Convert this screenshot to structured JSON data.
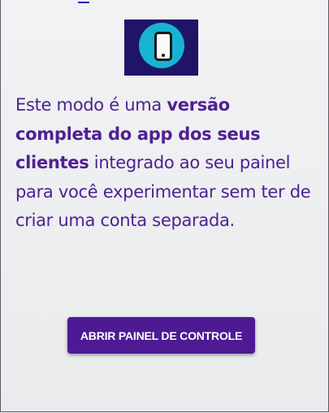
{
  "hero_icon": "smartphone-icon",
  "colors": {
    "accent": "#4d1a94",
    "text": "#4f2191",
    "icon_tile": "#1f1466",
    "icon_circle": "#18b2d4"
  },
  "description": {
    "part1": "Este modo é uma ",
    "highlight": "versão completa do app dos seus clientes",
    "part2": " integrado ao seu painel para você experimentar sem ter de criar uma conta separada."
  },
  "cta_button": {
    "label": "ABRIR PAINEL DE CONTROLE"
  }
}
